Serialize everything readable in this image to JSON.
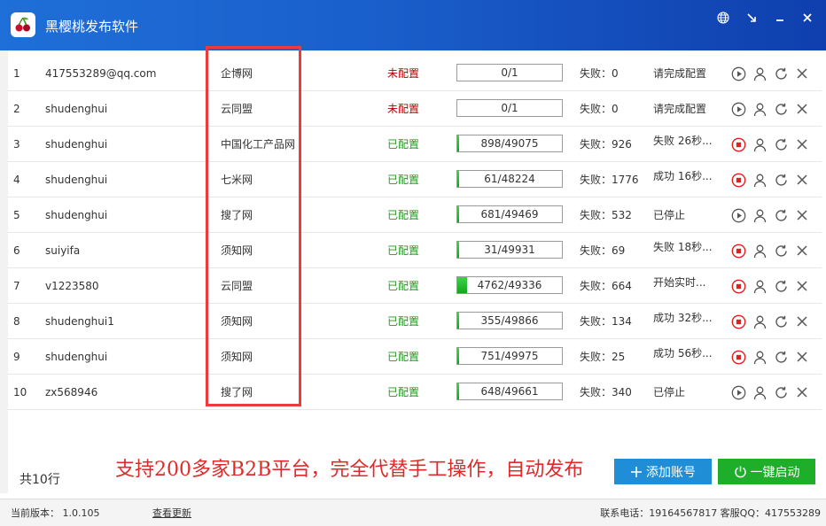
{
  "app": {
    "title": "黑樱桃发布软件"
  },
  "window_buttons": [
    "globe-icon",
    "collapse-icon",
    "minimize-icon",
    "close-icon"
  ],
  "colors": {
    "titlebar": "#1a5fcb",
    "unconfigured": "#b00000",
    "configured": "#1f9a1f",
    "highlight_box": "#f03a3a",
    "add_button": "#1f8ed6",
    "start_button": "#1fae2a",
    "progress_fill": "#13a51d"
  },
  "rows": [
    {
      "idx": "1",
      "account": "417553289@qq.com",
      "site": "企博网",
      "config": "未配置",
      "configured": false,
      "progress": "0/1",
      "done": 0,
      "total": 1,
      "fail": "失败：0",
      "status": "请完成配置",
      "running": false
    },
    {
      "idx": "2",
      "account": "shudenghui",
      "site": "云同盟",
      "config": "未配置",
      "configured": false,
      "progress": "0/1",
      "done": 0,
      "total": 1,
      "fail": "失败：0",
      "status": "请完成配置",
      "running": false
    },
    {
      "idx": "3",
      "account": "shudenghui",
      "site": "中国化工产品网",
      "config": "已配置",
      "configured": true,
      "progress": "898/49075",
      "done": 898,
      "total": 49075,
      "fail": "失败：926",
      "status": "失败 26秒...",
      "running": true
    },
    {
      "idx": "4",
      "account": "shudenghui",
      "site": "七米网",
      "config": "已配置",
      "configured": true,
      "progress": "61/48224",
      "done": 61,
      "total": 48224,
      "fail": "失败：1776",
      "status": "成功 16秒...",
      "running": true
    },
    {
      "idx": "5",
      "account": "shudenghui",
      "site": "搜了网",
      "config": "已配置",
      "configured": true,
      "progress": "681/49469",
      "done": 681,
      "total": 49469,
      "fail": "失败：532",
      "status": "已停止",
      "running": false
    },
    {
      "idx": "6",
      "account": "suiyifa",
      "site": "须知网",
      "config": "已配置",
      "configured": true,
      "progress": "31/49931",
      "done": 31,
      "total": 49931,
      "fail": "失败：69",
      "status": "失败 18秒...",
      "running": true
    },
    {
      "idx": "7",
      "account": "v1223580",
      "site": "云同盟",
      "config": "已配置",
      "configured": true,
      "progress": "4762/49336",
      "done": 4762,
      "total": 49336,
      "fail": "失败：664",
      "status": "开始实时...",
      "running": true
    },
    {
      "idx": "8",
      "account": "shudenghui1",
      "site": "须知网",
      "config": "已配置",
      "configured": true,
      "progress": "355/49866",
      "done": 355,
      "total": 49866,
      "fail": "失败：134",
      "status": "成功 32秒...",
      "running": true
    },
    {
      "idx": "9",
      "account": "shudenghui",
      "site": "须知网",
      "config": "已配置",
      "configured": true,
      "progress": "751/49975",
      "done": 751,
      "total": 49975,
      "fail": "失败：25",
      "status": "成功 56秒...",
      "running": true
    },
    {
      "idx": "10",
      "account": "zx568946",
      "site": "搜了网",
      "config": "已配置",
      "configured": true,
      "progress": "648/49661",
      "done": 648,
      "total": 49661,
      "fail": "失败：340",
      "status": "已停止",
      "running": false
    }
  ],
  "footer": {
    "total": "共10行",
    "slogan": "支持200多家B2B平台，完全代替手工操作，自动发布",
    "add_label": "添加账号",
    "start_label": "一键启动"
  },
  "status_bar": {
    "version": "当前版本：  1.0.105",
    "check_update": "查看更新",
    "contact": "联系电话：19164567817 客服QQ：417553289"
  }
}
